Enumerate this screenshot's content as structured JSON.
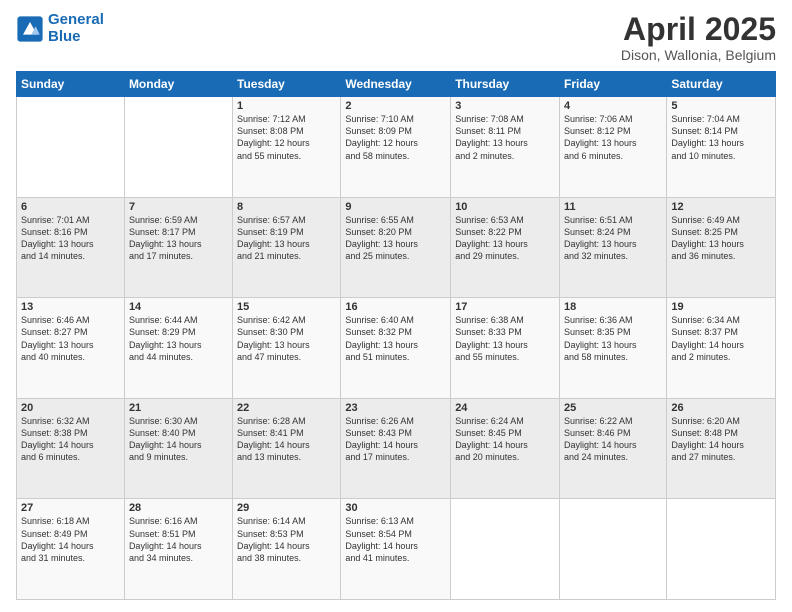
{
  "header": {
    "logo_line1": "General",
    "logo_line2": "Blue",
    "title": "April 2025",
    "subtitle": "Dison, Wallonia, Belgium"
  },
  "weekdays": [
    "Sunday",
    "Monday",
    "Tuesday",
    "Wednesday",
    "Thursday",
    "Friday",
    "Saturday"
  ],
  "weeks": [
    [
      {
        "day": "",
        "info": ""
      },
      {
        "day": "",
        "info": ""
      },
      {
        "day": "1",
        "info": "Sunrise: 7:12 AM\nSunset: 8:08 PM\nDaylight: 12 hours\nand 55 minutes."
      },
      {
        "day": "2",
        "info": "Sunrise: 7:10 AM\nSunset: 8:09 PM\nDaylight: 12 hours\nand 58 minutes."
      },
      {
        "day": "3",
        "info": "Sunrise: 7:08 AM\nSunset: 8:11 PM\nDaylight: 13 hours\nand 2 minutes."
      },
      {
        "day": "4",
        "info": "Sunrise: 7:06 AM\nSunset: 8:12 PM\nDaylight: 13 hours\nand 6 minutes."
      },
      {
        "day": "5",
        "info": "Sunrise: 7:04 AM\nSunset: 8:14 PM\nDaylight: 13 hours\nand 10 minutes."
      }
    ],
    [
      {
        "day": "6",
        "info": "Sunrise: 7:01 AM\nSunset: 8:16 PM\nDaylight: 13 hours\nand 14 minutes."
      },
      {
        "day": "7",
        "info": "Sunrise: 6:59 AM\nSunset: 8:17 PM\nDaylight: 13 hours\nand 17 minutes."
      },
      {
        "day": "8",
        "info": "Sunrise: 6:57 AM\nSunset: 8:19 PM\nDaylight: 13 hours\nand 21 minutes."
      },
      {
        "day": "9",
        "info": "Sunrise: 6:55 AM\nSunset: 8:20 PM\nDaylight: 13 hours\nand 25 minutes."
      },
      {
        "day": "10",
        "info": "Sunrise: 6:53 AM\nSunset: 8:22 PM\nDaylight: 13 hours\nand 29 minutes."
      },
      {
        "day": "11",
        "info": "Sunrise: 6:51 AM\nSunset: 8:24 PM\nDaylight: 13 hours\nand 32 minutes."
      },
      {
        "day": "12",
        "info": "Sunrise: 6:49 AM\nSunset: 8:25 PM\nDaylight: 13 hours\nand 36 minutes."
      }
    ],
    [
      {
        "day": "13",
        "info": "Sunrise: 6:46 AM\nSunset: 8:27 PM\nDaylight: 13 hours\nand 40 minutes."
      },
      {
        "day": "14",
        "info": "Sunrise: 6:44 AM\nSunset: 8:29 PM\nDaylight: 13 hours\nand 44 minutes."
      },
      {
        "day": "15",
        "info": "Sunrise: 6:42 AM\nSunset: 8:30 PM\nDaylight: 13 hours\nand 47 minutes."
      },
      {
        "day": "16",
        "info": "Sunrise: 6:40 AM\nSunset: 8:32 PM\nDaylight: 13 hours\nand 51 minutes."
      },
      {
        "day": "17",
        "info": "Sunrise: 6:38 AM\nSunset: 8:33 PM\nDaylight: 13 hours\nand 55 minutes."
      },
      {
        "day": "18",
        "info": "Sunrise: 6:36 AM\nSunset: 8:35 PM\nDaylight: 13 hours\nand 58 minutes."
      },
      {
        "day": "19",
        "info": "Sunrise: 6:34 AM\nSunset: 8:37 PM\nDaylight: 14 hours\nand 2 minutes."
      }
    ],
    [
      {
        "day": "20",
        "info": "Sunrise: 6:32 AM\nSunset: 8:38 PM\nDaylight: 14 hours\nand 6 minutes."
      },
      {
        "day": "21",
        "info": "Sunrise: 6:30 AM\nSunset: 8:40 PM\nDaylight: 14 hours\nand 9 minutes."
      },
      {
        "day": "22",
        "info": "Sunrise: 6:28 AM\nSunset: 8:41 PM\nDaylight: 14 hours\nand 13 minutes."
      },
      {
        "day": "23",
        "info": "Sunrise: 6:26 AM\nSunset: 8:43 PM\nDaylight: 14 hours\nand 17 minutes."
      },
      {
        "day": "24",
        "info": "Sunrise: 6:24 AM\nSunset: 8:45 PM\nDaylight: 14 hours\nand 20 minutes."
      },
      {
        "day": "25",
        "info": "Sunrise: 6:22 AM\nSunset: 8:46 PM\nDaylight: 14 hours\nand 24 minutes."
      },
      {
        "day": "26",
        "info": "Sunrise: 6:20 AM\nSunset: 8:48 PM\nDaylight: 14 hours\nand 27 minutes."
      }
    ],
    [
      {
        "day": "27",
        "info": "Sunrise: 6:18 AM\nSunset: 8:49 PM\nDaylight: 14 hours\nand 31 minutes."
      },
      {
        "day": "28",
        "info": "Sunrise: 6:16 AM\nSunset: 8:51 PM\nDaylight: 14 hours\nand 34 minutes."
      },
      {
        "day": "29",
        "info": "Sunrise: 6:14 AM\nSunset: 8:53 PM\nDaylight: 14 hours\nand 38 minutes."
      },
      {
        "day": "30",
        "info": "Sunrise: 6:13 AM\nSunset: 8:54 PM\nDaylight: 14 hours\nand 41 minutes."
      },
      {
        "day": "",
        "info": ""
      },
      {
        "day": "",
        "info": ""
      },
      {
        "day": "",
        "info": ""
      }
    ]
  ]
}
